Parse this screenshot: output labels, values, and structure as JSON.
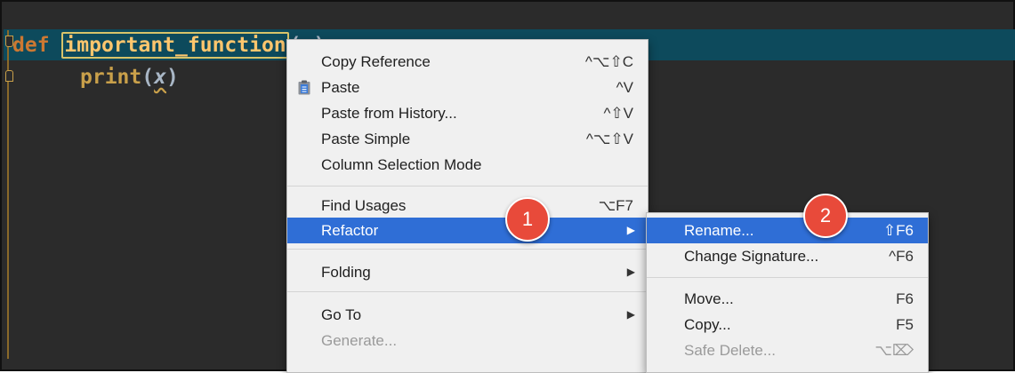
{
  "editor": {
    "line1": {
      "keyword": "def",
      "function_name": "important_function",
      "signature_rest": "(x):"
    },
    "line2": {
      "builtin": "print",
      "open_paren": "(",
      "param": "x",
      "close_paren": ")"
    }
  },
  "context_menu": {
    "items": [
      {
        "label": "Copy Reference",
        "shortcut": "^⌥⇧C"
      },
      {
        "label": "Paste",
        "shortcut": "^V",
        "icon": "clipboard-icon"
      },
      {
        "label": "Paste from History...",
        "shortcut": "^⇧V"
      },
      {
        "label": "Paste Simple",
        "shortcut": "^⌥⇧V"
      },
      {
        "label": "Column Selection Mode",
        "shortcut": ""
      },
      {
        "label": "Find Usages",
        "shortcut": "⌥F7"
      },
      {
        "label": "Refactor",
        "shortcut": "",
        "submenu_arrow": "▶",
        "selected": true
      },
      {
        "label": "Folding",
        "shortcut": "",
        "submenu_arrow": "▶"
      },
      {
        "label": "Go To",
        "shortcut": "",
        "submenu_arrow": "▶"
      },
      {
        "label": "Generate...",
        "shortcut": "",
        "disabled": true
      }
    ]
  },
  "refactor_submenu": {
    "items": [
      {
        "label": "Rename...",
        "shortcut": "⇧F6",
        "selected": true
      },
      {
        "label": "Change Signature...",
        "shortcut": "^F6"
      },
      {
        "label": "Move...",
        "shortcut": "F6"
      },
      {
        "label": "Copy...",
        "shortcut": "F5"
      },
      {
        "label": "Safe Delete...",
        "shortcut": "⌥⌦",
        "disabled": true
      }
    ]
  },
  "badges": {
    "step1": "1",
    "step2": "2"
  },
  "colors": {
    "editor_background": "#2b2b2b",
    "current_line": "#0d4a5c",
    "keyword": "#cc7832",
    "function_name": "#ffc66d",
    "menu_selection": "#2f6ed6",
    "badge": "#e84a3a"
  }
}
